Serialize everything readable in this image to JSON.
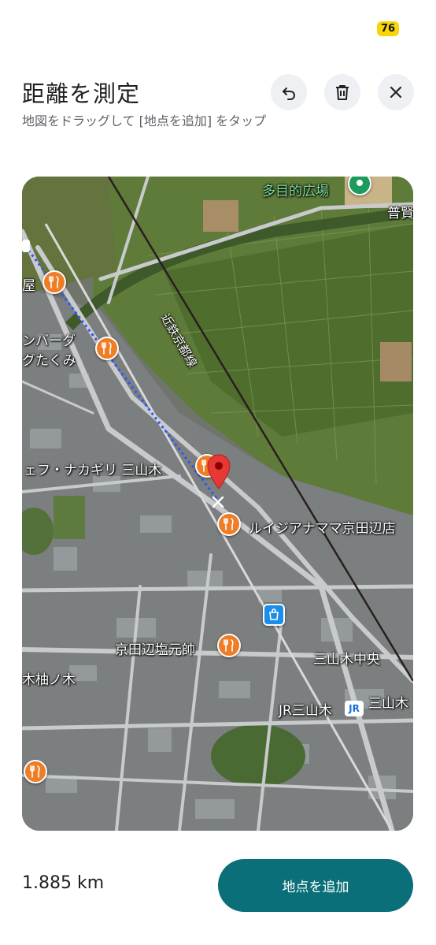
{
  "status": {
    "badge": "76"
  },
  "header": {
    "title": "距離を測定",
    "subtitle": "地図をドラッグして [地点を追加] をタップ",
    "undo_icon": "undo-icon",
    "delete_icon": "trash-icon",
    "close_icon": "close-icon"
  },
  "map": {
    "labels": {
      "plaza": "多目的広場",
      "fugen": "普賢",
      "railway": "近鉄京都線",
      "ya": "屋",
      "hamburg1": "ンバーグ",
      "hamburg2": "グたくみ",
      "chef": "ェフ・ナカギリ 三山木",
      "louisiana": "ルイジアナママ京田辺店",
      "shioganshi": "京田辺塩元帥",
      "sanyamagi_chuo": "三山木中央",
      "kiyunoki": "木柚ノ木",
      "jr_station": "JR三山木",
      "jr_logo": "JR",
      "sanyamagi": "三山木"
    },
    "colors": {
      "route": "#2b57ff",
      "pin": "#e53935",
      "poi": "#ee7d28"
    }
  },
  "footer": {
    "distance": "1.885 km",
    "add_button": "地点を追加"
  }
}
